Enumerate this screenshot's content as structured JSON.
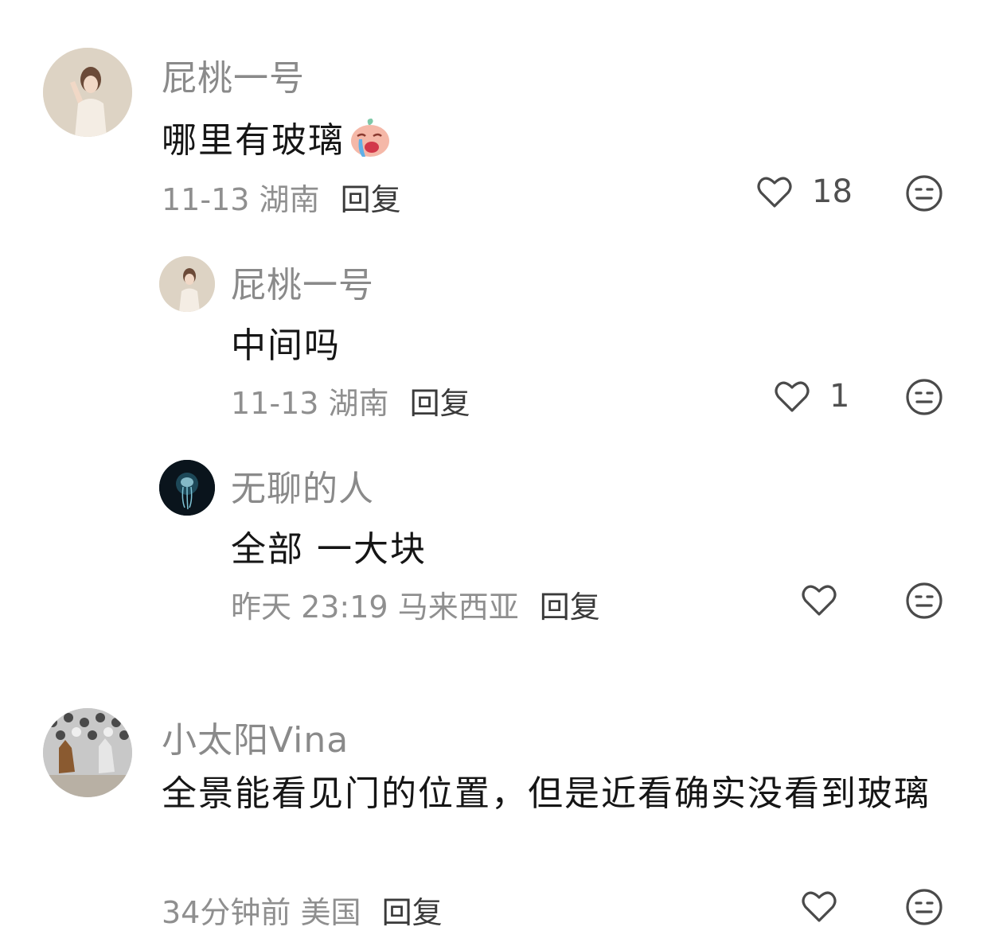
{
  "comments": [
    {
      "author": "屁桃一号",
      "text": "哪里有玻璃",
      "emoji": "crying-face-emoji",
      "time": "11-13",
      "location": "湖南",
      "reply_label": "回复",
      "likes": "18"
    },
    {
      "author": "屁桃一号",
      "text": "中间吗",
      "time": "11-13",
      "location": "湖南",
      "reply_label": "回复",
      "likes": "1"
    },
    {
      "author": "无聊的人",
      "text": "全部 一大块",
      "time": "昨天 23:19",
      "location": "马来西亚",
      "reply_label": "回复",
      "likes": ""
    },
    {
      "author": "小太阳Vina",
      "text": "全景能看见门的位置，但是近看确实没看到玻璃",
      "time": "34分钟前",
      "location": "美国",
      "reply_label": "回复",
      "likes": ""
    }
  ],
  "icons": {
    "like": "heart-outline-icon",
    "dislike": "meh-face-icon"
  },
  "colors": {
    "author": "#8a8a8a",
    "text": "#151515",
    "meta": "#8f8f8f",
    "icon": "#4a4a4a"
  }
}
